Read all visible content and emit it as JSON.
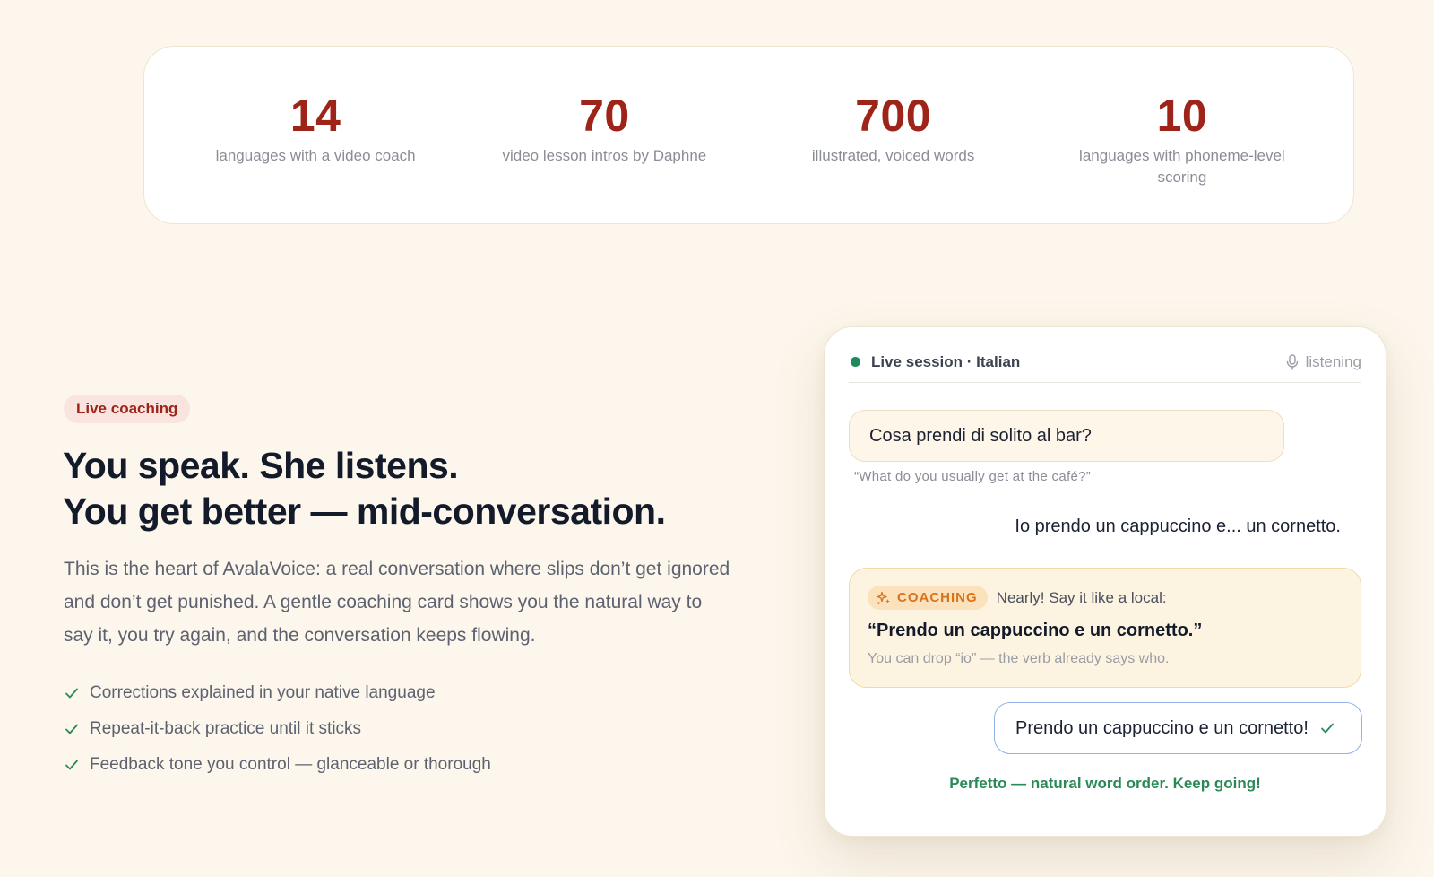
{
  "stats": [
    {
      "number": "14",
      "label": "languages with a video coach"
    },
    {
      "number": "70",
      "label": "video lesson intros by Daphne"
    },
    {
      "number": "700",
      "label": "illustrated, voiced words"
    },
    {
      "number": "10",
      "label": "languages with phoneme-level scoring"
    }
  ],
  "feature": {
    "badge": "Live coaching",
    "headline_line1": "You speak. She listens.",
    "headline_line2": "You get better — mid-conversation.",
    "lead": "This is the heart of AvalaVoice: a real conversation where slips don’t get ignored and don’t get punished. A gentle coaching card shows you the natural way to say it, you try again, and the conversation keeps flowing.",
    "benefits": [
      "Corrections explained in your native language",
      "Repeat-it-back practice until it sticks",
      "Feedback tone you control — glanceable or thorough"
    ]
  },
  "session": {
    "title": "Live session · Italian",
    "status": "listening",
    "prompt": "Cosa prendi di solito al bar?",
    "prompt_translation": "“What do you usually get at the café?”",
    "user_utterance": "Io prendo un cappuccino e... un cornetto.",
    "coaching": {
      "tag": "COACHING",
      "intro": "Nearly! Say it like a local:",
      "correction": "“Prendo un cappuccino e un cornetto.”",
      "note": "You can drop “io” — the verb already says who."
    },
    "retry": "Prendo un cappuccino e un cornetto!",
    "success": "Perfetto — natural word order. Keep going!"
  },
  "colors": {
    "background": "#fcf6ec",
    "accent_red": "#9e2419",
    "live_green": "#1e8a5a",
    "coaching_orange": "#d9731a",
    "retry_border": "#8fb3e8"
  },
  "icons": [
    "check-icon",
    "mic-icon",
    "sparkle-icon"
  ]
}
